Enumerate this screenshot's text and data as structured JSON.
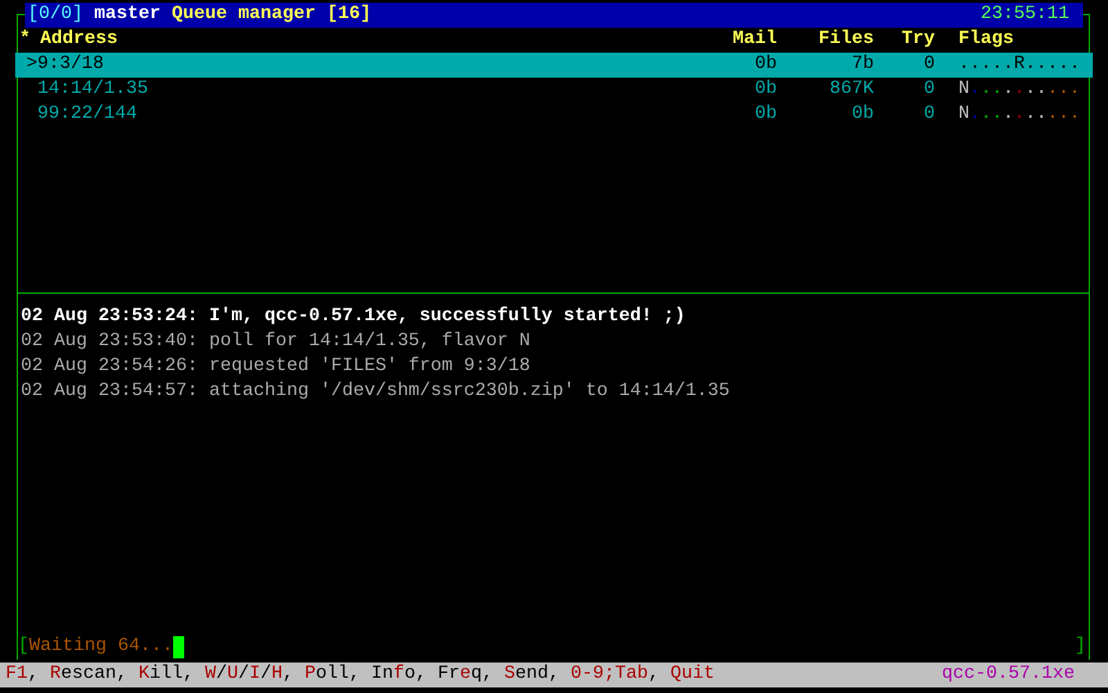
{
  "title_bar": {
    "counter": "[0/0]",
    "node": "master",
    "title": "Queue manager [16]",
    "clock": "23:55:11"
  },
  "queue": {
    "columns": {
      "marker": "*",
      "address": "Address",
      "mail": "Mail",
      "files": "Files",
      "try": "Try",
      "flags": "Flags"
    },
    "rows": [
      {
        "address": ">9:3/18",
        "mail": "0b",
        "files": "7b",
        "try": "0",
        "flags": ".....R.....",
        "selected": true
      },
      {
        "address": "14:14/1.35",
        "mail": "0b",
        "files": "867K",
        "try": "0",
        "flags": [
          {
            "char": "N",
            "color": "#c0c0c0"
          },
          {
            "char": ".",
            "color": "#0000aa"
          },
          {
            "char": ".",
            "color": "#00aa00"
          },
          {
            "char": ".",
            "color": "#00aa00"
          },
          {
            "char": ".",
            "color": "#c0c0c0"
          },
          {
            "char": ".",
            "color": "#aa0000"
          },
          {
            "char": ".",
            "color": "#c0c0c0"
          },
          {
            "char": ".",
            "color": "#c0c0c0"
          },
          {
            "char": ".",
            "color": "#aa5500"
          },
          {
            "char": ".",
            "color": "#aa5500"
          },
          {
            "char": ".",
            "color": "#aa5500"
          }
        ],
        "selected": false
      },
      {
        "address": "99:22/144",
        "mail": "0b",
        "files": "0b",
        "try": "0",
        "flags": [
          {
            "char": "N",
            "color": "#c0c0c0"
          },
          {
            "char": ".",
            "color": "#0000aa"
          },
          {
            "char": ".",
            "color": "#00aa00"
          },
          {
            "char": ".",
            "color": "#00aa00"
          },
          {
            "char": ".",
            "color": "#c0c0c0"
          },
          {
            "char": ".",
            "color": "#aa0000"
          },
          {
            "char": ".",
            "color": "#c0c0c0"
          },
          {
            "char": ".",
            "color": "#c0c0c0"
          },
          {
            "char": ".",
            "color": "#aa5500"
          },
          {
            "char": ".",
            "color": "#aa5500"
          },
          {
            "char": ".",
            "color": "#aa5500"
          }
        ],
        "selected": false
      }
    ]
  },
  "log": [
    {
      "text": "02 Aug 23:53:24: I'm, qcc-0.57.1xe, successfully started! ;)",
      "bold": true
    },
    {
      "text": "02 Aug 23:53:40: poll for 14:14/1.35, flavor N",
      "bold": false
    },
    {
      "text": "02 Aug 23:54:26: requested 'FILES' from 9:3/18",
      "bold": false
    },
    {
      "text": "02 Aug 23:54:57: attaching '/dev/shm/ssrc230b.zip' to 14:14/1.35",
      "bold": false
    }
  ],
  "status_line": {
    "open": "[",
    "text": "Waiting 64...",
    "close": "]"
  },
  "key_bar": {
    "commands": [
      {
        "parts": [
          {
            "text": "F1",
            "hot": true
          },
          {
            "text": ", ",
            "hot": false
          }
        ]
      },
      {
        "parts": [
          {
            "text": "R",
            "hot": true
          },
          {
            "text": "escan, ",
            "hot": false
          }
        ]
      },
      {
        "parts": [
          {
            "text": "K",
            "hot": true
          },
          {
            "text": "ill, ",
            "hot": false
          }
        ]
      },
      {
        "parts": [
          {
            "text": "W",
            "hot": true
          },
          {
            "text": "/",
            "hot": false
          },
          {
            "text": "U",
            "hot": true
          },
          {
            "text": "/",
            "hot": false
          },
          {
            "text": "I",
            "hot": true
          },
          {
            "text": "/",
            "hot": false
          },
          {
            "text": "H",
            "hot": true
          },
          {
            "text": ", ",
            "hot": false
          }
        ]
      },
      {
        "parts": [
          {
            "text": "P",
            "hot": true
          },
          {
            "text": "oll, ",
            "hot": false
          }
        ]
      },
      {
        "parts": [
          {
            "text": "In",
            "hot": false
          },
          {
            "text": "f",
            "hot": true
          },
          {
            "text": "o, ",
            "hot": false
          }
        ]
      },
      {
        "parts": [
          {
            "text": "Fr",
            "hot": false
          },
          {
            "text": "e",
            "hot": true
          },
          {
            "text": "q, ",
            "hot": false
          }
        ]
      },
      {
        "parts": [
          {
            "text": "S",
            "hot": true
          },
          {
            "text": "end, ",
            "hot": false
          }
        ]
      },
      {
        "parts": [
          {
            "text": "0-9;Tab",
            "hot": true
          },
          {
            "text": ", ",
            "hot": false
          }
        ]
      },
      {
        "parts": [
          {
            "text": "Quit",
            "hot": true
          }
        ]
      }
    ],
    "version": "qcc-0.57.1xe"
  }
}
